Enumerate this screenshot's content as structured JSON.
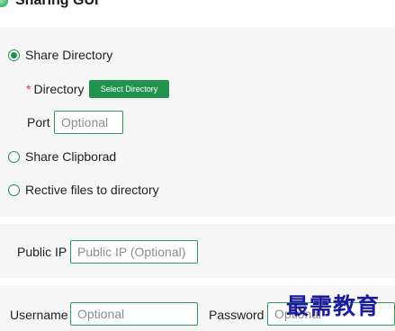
{
  "app": {
    "title": "Sharing GUI",
    "logo_icon": "app-logo-icon"
  },
  "share_options": {
    "share_directory": {
      "label": "Share Directory",
      "selected": true
    },
    "directory": {
      "required_mark": "*",
      "label": "Directory",
      "button_label": "Select Directory"
    },
    "port": {
      "label": "Port",
      "placeholder": "Optional",
      "value": ""
    },
    "share_clipboard": {
      "label": "Share Clipborad",
      "selected": false
    },
    "receive_files": {
      "label": "Rective files to directory",
      "selected": false
    }
  },
  "network": {
    "public_ip": {
      "label": "Public IP",
      "placeholder": "Public IP (Optional)",
      "value": ""
    }
  },
  "auth": {
    "username": {
      "label": "Username",
      "placeholder": "Optional",
      "value": ""
    },
    "password": {
      "label": "Password",
      "placeholder": "Optional",
      "value": ""
    }
  },
  "watermark": {
    "text": "最需教育"
  },
  "colors": {
    "accent": "#22924f",
    "required": "#d23b3b",
    "panel_bg": "#f6f6f6"
  }
}
